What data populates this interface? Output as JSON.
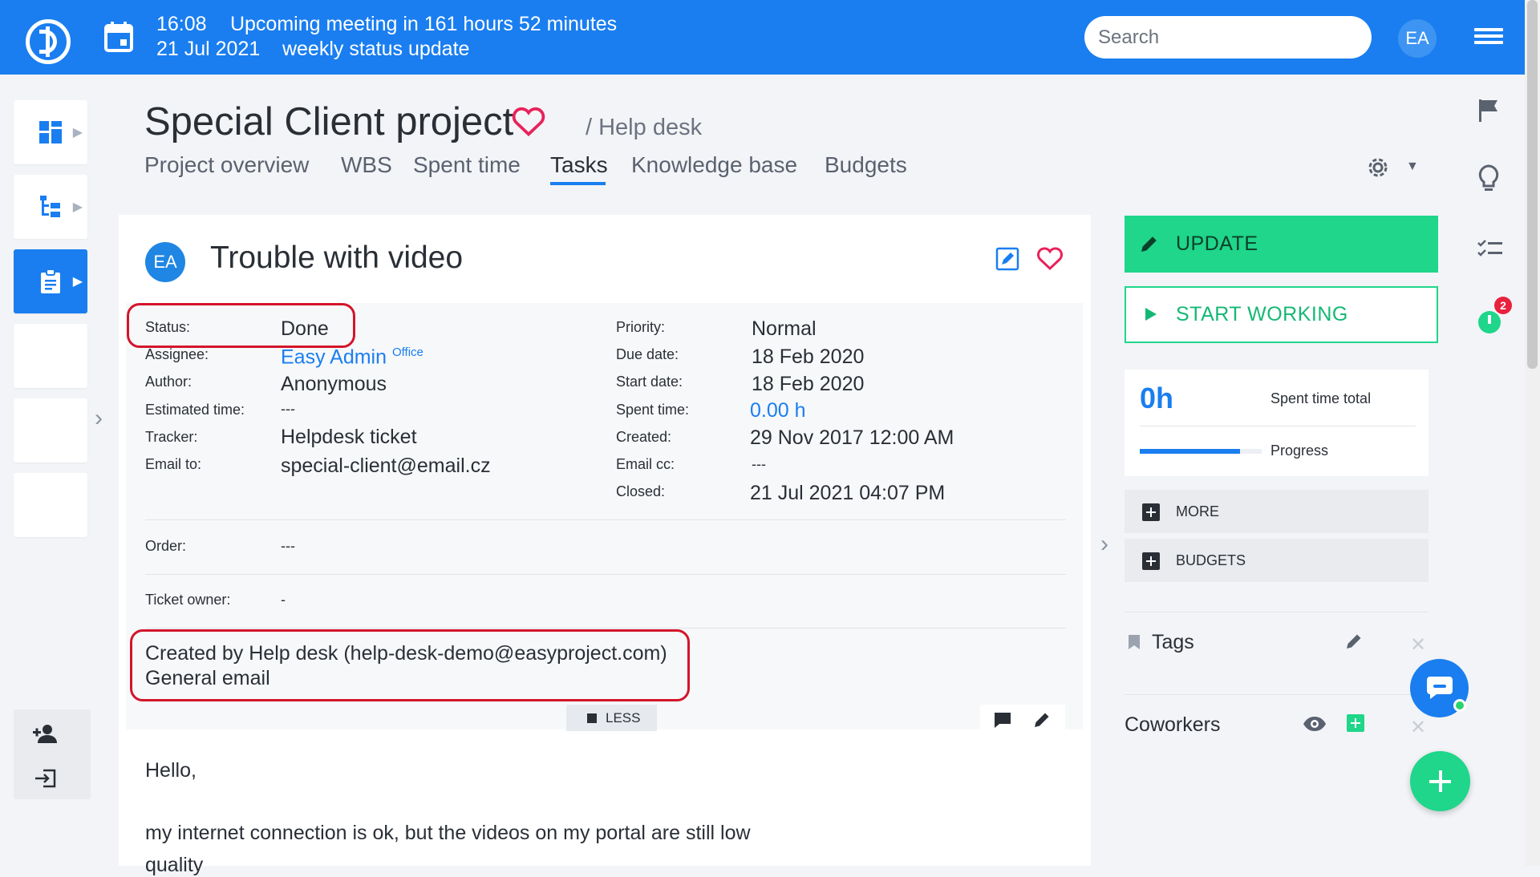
{
  "topbar": {
    "meeting_time": "16:08",
    "meeting_text": "Upcoming meeting in 161 hours 52 minutes",
    "meeting_date": "21 Jul 2021",
    "meeting_title": "weekly status update",
    "search_placeholder": "Search",
    "user_initials": "EA"
  },
  "project": {
    "title": "Special Client project",
    "breadcrumb": "/ Help desk",
    "tabs": [
      "Project overview",
      "WBS",
      "Spent time",
      "Tasks",
      "Knowledge base",
      "Budgets"
    ],
    "active_tab": "Tasks"
  },
  "task": {
    "author_initials": "EA",
    "title": "Trouble with video",
    "left_attrs": [
      {
        "label": "Status:",
        "value": "Done"
      },
      {
        "label": "Assignee:",
        "value": "Easy Admin",
        "extra": "Office"
      },
      {
        "label": "Author:",
        "value": "Anonymous"
      },
      {
        "label": "Estimated time:",
        "value": "---"
      },
      {
        "label": "Tracker:",
        "value": "Helpdesk ticket"
      },
      {
        "label": "Email to:",
        "value": "special-client@email.cz"
      }
    ],
    "right_attrs": [
      {
        "label": "Priority:",
        "value": "Normal"
      },
      {
        "label": "Due date:",
        "value": "18 Feb 2020"
      },
      {
        "label": "Start date:",
        "value": "18 Feb 2020"
      },
      {
        "label": "Spent time:",
        "value": "0.00 h"
      },
      {
        "label": "Created:",
        "value": "29 Nov 2017 12:00 AM"
      },
      {
        "label": "Email cc:",
        "value": "---"
      },
      {
        "label": "Closed:",
        "value": "21 Jul 2021 04:07 PM"
      }
    ],
    "order_label": "Order:",
    "order_value": "---",
    "ticket_owner_label": "Ticket owner:",
    "ticket_owner_value": "-",
    "created_by": "Created by Help desk (help-desk-demo@easyproject.com)",
    "general_email": "General email",
    "less_label": "LESS",
    "description_lines": [
      "Hello,",
      "my internet connection is ok, but the videos on my portal are still low",
      "quality"
    ]
  },
  "sidebar_right": {
    "update_label": "UPDATE",
    "start_label": "START WORKING",
    "spent_value": "0h",
    "spent_label": "Spent time total",
    "progress_label": "Progress",
    "progress_fraction": 0.82,
    "more_label": "MORE",
    "budgets_label": "BUDGETS",
    "tags_label": "Tags",
    "coworkers_label": "Coworkers"
  },
  "rail": {
    "timer_badge": "2"
  },
  "colors": {
    "brand_blue": "#1a7ef0",
    "accent_green": "#1fd68a",
    "highlight_red": "#d3152a",
    "heart_pink": "#e8225a"
  }
}
